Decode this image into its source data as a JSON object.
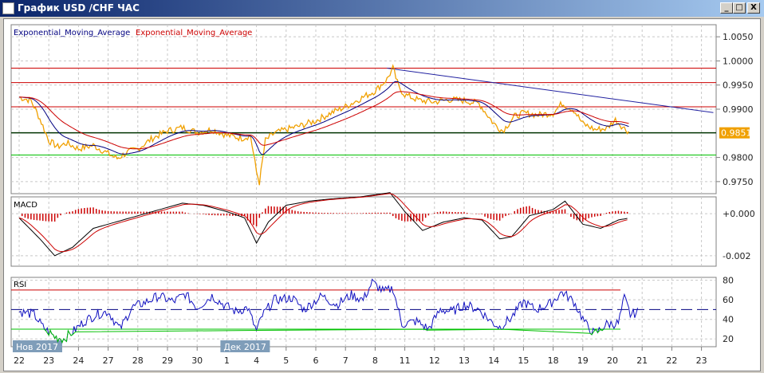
{
  "window": {
    "title": "График USD /CHF  ЧАС",
    "minimize": "_",
    "maximize": "□",
    "close": "X"
  },
  "legend": {
    "ema1": "Exponential_Moving_Average",
    "ema2": "Exponential_Moving_Average",
    "macd": "MACD",
    "rsi": "RSI"
  },
  "colors": {
    "price": "#f0a000",
    "ema_fast": "#000080",
    "ema_slow": "#cc0000",
    "support": "#00c000",
    "level": "#cc0000",
    "last_price_bg": "#f0a000"
  },
  "chart_data": [
    {
      "type": "line",
      "title": "USD/CHF H1",
      "ylim": [
        0.9725,
        1.0075
      ],
      "yticks": [
        "1.0050",
        "1.0000",
        "0.9950",
        "0.9900",
        "0.9800",
        "0.9750"
      ],
      "last_price": "0.9851",
      "xticks": [
        "22",
        "23",
        "24",
        "27",
        "28",
        "29",
        "30",
        "1",
        "4",
        "5",
        "6",
        "7",
        "8",
        "11",
        "12",
        "13",
        "14",
        "15",
        "18",
        "19",
        "20",
        "21",
        "22",
        "23"
      ],
      "month_labels": [
        {
          "label": "Нов 2017",
          "slot": 0
        },
        {
          "label": "Дек 2017",
          "slot": 7
        }
      ],
      "hlines": {
        "red": [
          0.9985,
          0.9955,
          0.9905
        ],
        "black": [
          0.9851
        ],
        "green": [
          0.9805
        ]
      },
      "trendline": [
        [
          12.4,
          0.9985
        ],
        [
          23.4,
          0.9893
        ]
      ],
      "price": [
        [
          0,
          0.9925
        ],
        [
          0.4,
          0.9918
        ],
        [
          0.7,
          0.988
        ],
        [
          1,
          0.9835
        ],
        [
          1.3,
          0.9822
        ],
        [
          1.6,
          0.983
        ],
        [
          2,
          0.9818
        ],
        [
          2.5,
          0.9825
        ],
        [
          3,
          0.9808
        ],
        [
          3.3,
          0.9798
        ],
        [
          3.7,
          0.9812
        ],
        [
          4,
          0.9818
        ],
        [
          4.5,
          0.984
        ],
        [
          5,
          0.9855
        ],
        [
          5.5,
          0.9862
        ],
        [
          6,
          0.9852
        ],
        [
          6.5,
          0.9858
        ],
        [
          7,
          0.9846
        ],
        [
          7.5,
          0.984
        ],
        [
          7.8,
          0.9845
        ],
        [
          8,
          0.977
        ],
        [
          8.1,
          0.9748
        ],
        [
          8.3,
          0.9835
        ],
        [
          8.6,
          0.985
        ],
        [
          9,
          0.9858
        ],
        [
          9.5,
          0.9866
        ],
        [
          10,
          0.9876
        ],
        [
          10.5,
          0.9892
        ],
        [
          11,
          0.9905
        ],
        [
          11.5,
          0.9922
        ],
        [
          12,
          0.9938
        ],
        [
          12.4,
          0.9962
        ],
        [
          12.6,
          0.9985
        ],
        [
          12.8,
          0.9945
        ],
        [
          13,
          0.993
        ],
        [
          13.5,
          0.9918
        ],
        [
          14,
          0.9915
        ],
        [
          14.5,
          0.992
        ],
        [
          15,
          0.9918
        ],
        [
          15.5,
          0.9912
        ],
        [
          16,
          0.987
        ],
        [
          16.3,
          0.9855
        ],
        [
          16.7,
          0.9885
        ],
        [
          17,
          0.9892
        ],
        [
          17.5,
          0.9888
        ],
        [
          18,
          0.9892
        ],
        [
          18.3,
          0.9912
        ],
        [
          18.7,
          0.9898
        ],
        [
          19,
          0.987
        ],
        [
          19.4,
          0.9858
        ],
        [
          19.8,
          0.986
        ],
        [
          20.1,
          0.9878
        ],
        [
          20.4,
          0.986
        ],
        [
          20.6,
          0.9852
        ]
      ],
      "ema_spans": [
        6,
        14
      ]
    },
    {
      "type": "line",
      "title": "MACD",
      "yticks": [
        "+0.000",
        "-0.002"
      ],
      "ylim": [
        -0.0025,
        0.0008
      ],
      "macd": [
        [
          0,
          -0.0002
        ],
        [
          0.7,
          -0.0012
        ],
        [
          1.2,
          -0.002
        ],
        [
          1.8,
          -0.0016
        ],
        [
          2.5,
          -0.0007
        ],
        [
          3.5,
          -0.0003
        ],
        [
          4.5,
          0.0001
        ],
        [
          5.5,
          0.0005
        ],
        [
          6.2,
          0.0004
        ],
        [
          7,
          0.0001
        ],
        [
          7.6,
          -0.0002
        ],
        [
          8,
          -0.0014
        ],
        [
          8.4,
          -0.0004
        ],
        [
          9,
          0.0004
        ],
        [
          9.8,
          0.0006
        ],
        [
          10.5,
          0.0007
        ],
        [
          11.5,
          0.0008
        ],
        [
          12.5,
          0.001
        ],
        [
          13,
          0.0001
        ],
        [
          13.6,
          -0.0008
        ],
        [
          14.3,
          -0.0004
        ],
        [
          15,
          -0.0002
        ],
        [
          15.6,
          -0.0003
        ],
        [
          16.2,
          -0.0012
        ],
        [
          16.6,
          -0.0011
        ],
        [
          17.2,
          -0.0001
        ],
        [
          18,
          0.0002
        ],
        [
          18.4,
          0.0006
        ],
        [
          19,
          -0.0005
        ],
        [
          19.6,
          -0.0007
        ],
        [
          20.2,
          -0.0003
        ],
        [
          20.6,
          -0.0002
        ]
      ],
      "signal_span": 5
    },
    {
      "type": "line",
      "title": "RSI",
      "yticks": [
        "80",
        "60",
        "40",
        "20"
      ],
      "ylim": [
        12,
        83
      ],
      "levels": [
        70,
        50,
        30
      ],
      "rsi": [
        [
          0,
          48
        ],
        [
          0.5,
          45
        ],
        [
          0.8,
          32
        ],
        [
          1.2,
          22
        ],
        [
          1.5,
          20
        ],
        [
          1.8,
          27
        ],
        [
          2.2,
          38
        ],
        [
          2.6,
          45
        ],
        [
          3,
          48
        ],
        [
          3.4,
          30
        ],
        [
          3.8,
          52
        ],
        [
          4.3,
          58
        ],
        [
          4.7,
          64
        ],
        [
          5.2,
          58
        ],
        [
          5.6,
          66
        ],
        [
          6,
          52
        ],
        [
          6.5,
          64
        ],
        [
          6.9,
          55
        ],
        [
          7.3,
          48
        ],
        [
          7.7,
          52
        ],
        [
          8,
          28
        ],
        [
          8.2,
          44
        ],
        [
          8.6,
          60
        ],
        [
          9.2,
          62
        ],
        [
          9.6,
          50
        ],
        [
          10.2,
          64
        ],
        [
          10.7,
          55
        ],
        [
          11.2,
          65
        ],
        [
          11.6,
          60
        ],
        [
          11.9,
          78
        ],
        [
          12.3,
          68
        ],
        [
          12.6,
          72
        ],
        [
          12.9,
          35
        ],
        [
          13.4,
          38
        ],
        [
          13.8,
          30
        ],
        [
          14.2,
          50
        ],
        [
          14.6,
          48
        ],
        [
          15,
          55
        ],
        [
          15.5,
          50
        ],
        [
          15.9,
          38
        ],
        [
          16.2,
          32
        ],
        [
          16.6,
          42
        ],
        [
          17,
          58
        ],
        [
          17.4,
          50
        ],
        [
          17.9,
          56
        ],
        [
          18.3,
          68
        ],
        [
          18.7,
          58
        ],
        [
          19.1,
          35
        ],
        [
          19.4,
          25
        ],
        [
          19.8,
          35
        ],
        [
          20.2,
          36
        ],
        [
          20.4,
          62
        ],
        [
          20.6,
          45
        ],
        [
          20.9,
          48
        ]
      ]
    }
  ]
}
